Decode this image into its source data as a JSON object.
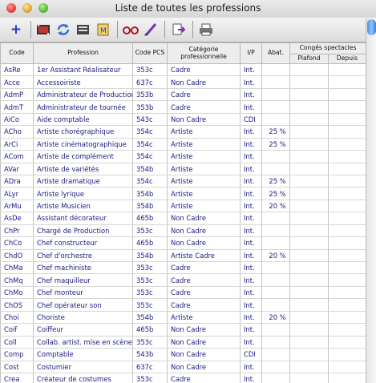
{
  "window": {
    "title": "Liste de toutes les professions"
  },
  "toolbar": {
    "icons": [
      "plus-icon",
      "film-icon",
      "refresh-icon",
      "database-icon",
      "mail-merge-icon",
      "glasses-icon",
      "pen-icon",
      "export-icon",
      "printer-icon"
    ],
    "plus_glyph": "+"
  },
  "table": {
    "headers": {
      "code": "Code",
      "profession": "Profession",
      "code_pcs": "Code PCS",
      "categorie": "Catégorie professionnelle",
      "ip": "I/P",
      "abat": "Abat.",
      "conges": "Congés spectacles",
      "plafond": "Plafond",
      "depuis": "Depuis"
    },
    "rows": [
      [
        "AsRe",
        "1er Assistant Réalisateur",
        "353c",
        "Cadre",
        "Int.",
        ""
      ],
      [
        "Acce",
        "Accessoiriste",
        "637c",
        "Non Cadre",
        "Int.",
        ""
      ],
      [
        "AdmP",
        "Administrateur de Production",
        "353b",
        "Cadre",
        "Int.",
        ""
      ],
      [
        "AdmT",
        "Administrateur de tournée",
        "353b",
        "Cadre",
        "Int.",
        ""
      ],
      [
        "AiCo",
        "Aide comptable",
        "543c",
        "Non Cadre",
        "CDI",
        ""
      ],
      [
        "ACho",
        "Artiste chorégraphique",
        "354c",
        "Artiste",
        "Int.",
        "25 %"
      ],
      [
        "ArCi",
        "Artiste cinématographique",
        "354c",
        "Artiste",
        "Int.",
        "25 %"
      ],
      [
        "ACom",
        "Artiste de complément",
        "354c",
        "Artiste",
        "Int.",
        ""
      ],
      [
        "AVar",
        "Artiste de variétés",
        "354b",
        "Artiste",
        "Int.",
        ""
      ],
      [
        "ADra",
        "Artiste dramatique",
        "354c",
        "Artiste",
        "Int.",
        "25 %"
      ],
      [
        "ALyr",
        "Artiste lyrique",
        "354b",
        "Artiste",
        "Int.",
        "25 %"
      ],
      [
        "ArMu",
        "Artiste Musicien",
        "354b",
        "Artiste",
        "Int.",
        "20 %"
      ],
      [
        "AsDe",
        "Assistant décorateur",
        "465b",
        "Non Cadre",
        "Int.",
        ""
      ],
      [
        "ChPr",
        "Chargé de Production",
        "353c",
        "Non Cadre",
        "Int.",
        ""
      ],
      [
        "ChCo",
        "Chef constructeur",
        "465b",
        "Non Cadre",
        "Int.",
        ""
      ],
      [
        "ChdO",
        "Chef d'orchestre",
        "354b",
        "Artiste Cadre",
        "Int.",
        "20 %"
      ],
      [
        "ChMa",
        "Chef machiniste",
        "353c",
        "Cadre",
        "Int.",
        ""
      ],
      [
        "ChMq",
        "Chef maquilleur",
        "353c",
        "Cadre",
        "Int.",
        ""
      ],
      [
        "ChMo",
        "Chef monteur",
        "353c",
        "Cadre",
        "Int.",
        ""
      ],
      [
        "ChOS",
        "Chef opérateur son",
        "353c",
        "Cadre",
        "Int.",
        ""
      ],
      [
        "Choi",
        "Choriste",
        "354b",
        "Artiste",
        "Int.",
        "20 %"
      ],
      [
        "Coif",
        "Coiffeur",
        "465b",
        "Non Cadre",
        "Int.",
        ""
      ],
      [
        "Coll",
        "Collab. artist. mise en scène",
        "353c",
        "Non Cadre",
        "Int.",
        ""
      ],
      [
        "Comp",
        "Comptable",
        "543b",
        "Non Cadre",
        "CDI",
        ""
      ],
      [
        "Cost",
        "Costumier",
        "637c",
        "Non Cadre",
        "Int.",
        ""
      ],
      [
        "Crea",
        "Créateur de costumes",
        "353c",
        "Cadre",
        "Int.",
        ""
      ]
    ]
  }
}
